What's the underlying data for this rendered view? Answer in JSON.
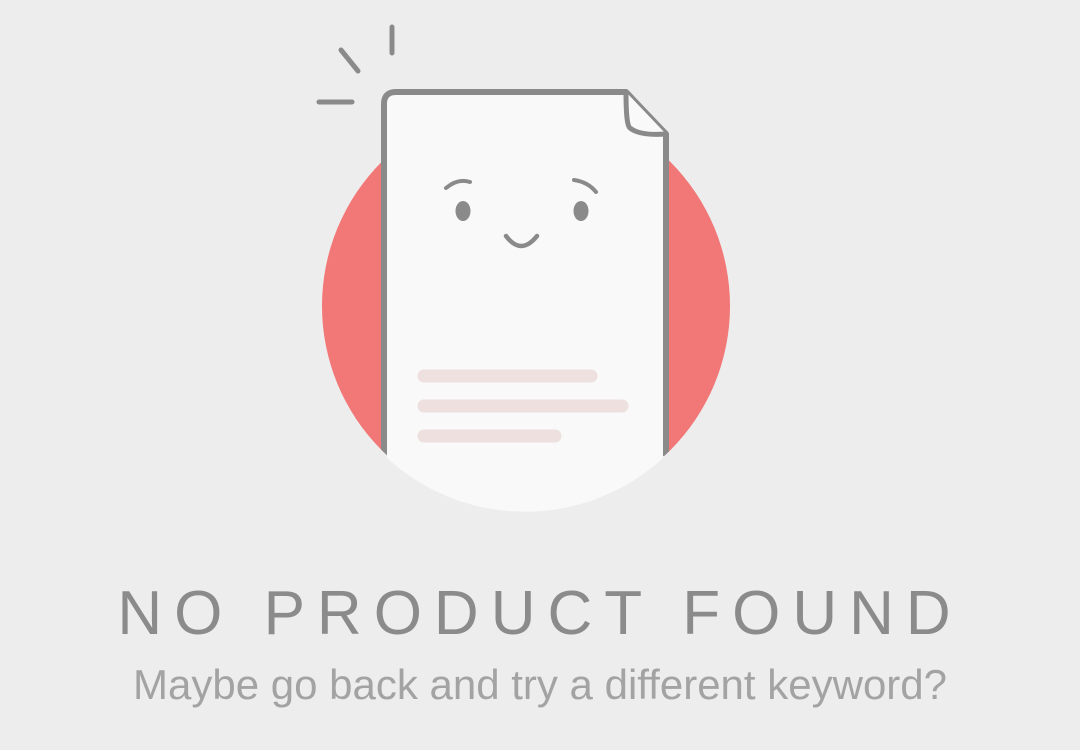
{
  "empty_state": {
    "title": "NO PRODUCT FOUND",
    "message": "Maybe go back and try a different keyword?",
    "illustration_icon": "sad-document-icon"
  },
  "colors": {
    "background": "#ededed",
    "accent_circle": "#f27777",
    "document_fill": "#f9f9f9",
    "outline": "#8a8a8a",
    "text_lines": "#ede0df",
    "title_text": "#8b8b8b",
    "message_text": "#a3a3a3"
  }
}
